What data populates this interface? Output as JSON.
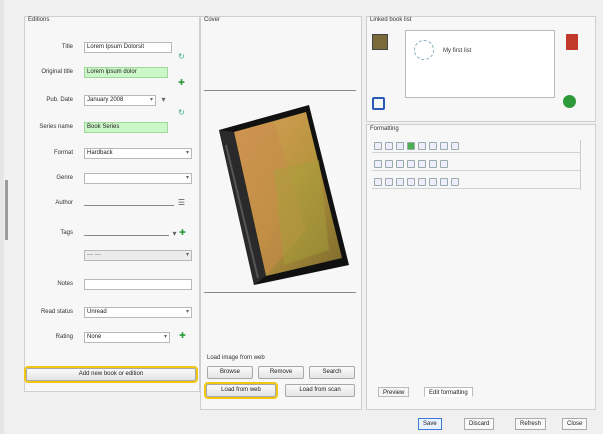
{
  "details": {
    "title": "Editions",
    "fields": [
      {
        "label": "Title",
        "value": "Lorem Ipsum Dolorsit",
        "style": "plain"
      },
      {
        "label": "Original title",
        "value": "Lorem ipsum dolor",
        "style": "green"
      },
      {
        "label": "Pub. Date",
        "value": "January 2008",
        "style": "combo"
      },
      {
        "label": "Series name",
        "value": "Book Series",
        "style": "green"
      },
      {
        "label": "Format",
        "value": "Hardback",
        "style": "combo"
      },
      {
        "label": "Genre",
        "value": "",
        "style": "combo"
      },
      {
        "label": "Author",
        "value": "",
        "style": "plain"
      },
      {
        "label": "Tags",
        "value": "",
        "style": "combo"
      },
      {
        "label": "",
        "value": "— —",
        "style": "disabled"
      },
      {
        "label": "Notes",
        "value": "",
        "style": "plain"
      },
      {
        "label": "Read status",
        "value": "Unread",
        "style": "combo"
      },
      {
        "label": "Rating",
        "value": "None",
        "style": "combo"
      }
    ],
    "bottom_button": "Add new book or edition"
  },
  "cover": {
    "title": "Cover",
    "filter_label": "Load image from web",
    "buttons_row1": [
      "Browse",
      "Remove",
      "Search"
    ],
    "buttons_row2": [
      "Load from web",
      "Load from scan"
    ]
  },
  "linked": {
    "title": "Linked book list",
    "item_label": "My first list"
  },
  "formatting": {
    "title": "Formatting"
  },
  "tabs": [
    "Preview",
    "Edit formatting"
  ],
  "status_buttons": [
    "Save",
    "Discard",
    "Refresh",
    "Close"
  ],
  "colors": {
    "green": "#ccf7c8",
    "highlight": "#f3c613",
    "accent": "#3b7bd5"
  }
}
